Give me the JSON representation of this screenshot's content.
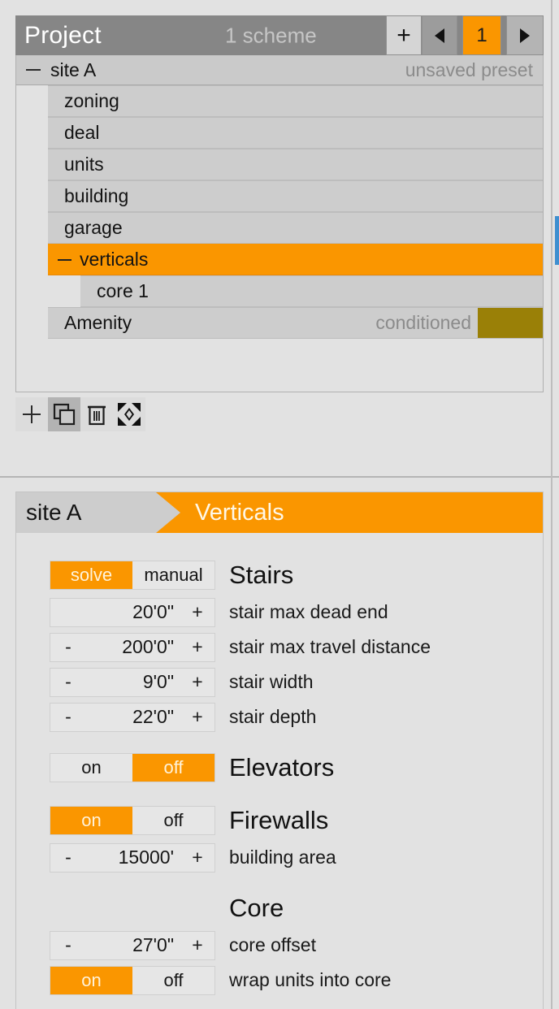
{
  "project_panel": {
    "title": "Project",
    "scheme_count": "1 scheme",
    "controls": {
      "add_label": "+",
      "prev_label": "prev-scheme",
      "current_scheme": "1",
      "next_label": "next-scheme"
    },
    "preset_row": {
      "name": "site A",
      "state": "unsaved preset"
    },
    "tree": [
      {
        "label": "zoning",
        "level": 1,
        "selected": false,
        "dash": false,
        "meta": "",
        "swatch": ""
      },
      {
        "label": "deal",
        "level": 1,
        "selected": false,
        "dash": false,
        "meta": "",
        "swatch": ""
      },
      {
        "label": "units",
        "level": 1,
        "selected": false,
        "dash": false,
        "meta": "",
        "swatch": ""
      },
      {
        "label": "building",
        "level": 1,
        "selected": false,
        "dash": false,
        "meta": "",
        "swatch": ""
      },
      {
        "label": "garage",
        "level": 1,
        "selected": false,
        "dash": false,
        "meta": "",
        "swatch": ""
      },
      {
        "label": "verticals",
        "level": 1,
        "selected": true,
        "dash": true,
        "meta": "",
        "swatch": ""
      },
      {
        "label": "core 1",
        "level": 2,
        "selected": false,
        "dash": false,
        "meta": "",
        "swatch": ""
      },
      {
        "label": "Amenity",
        "level": 1,
        "selected": false,
        "dash": false,
        "meta": "conditioned",
        "swatch": "#9a8007"
      }
    ],
    "toolbar": [
      {
        "name": "add-item-button",
        "icon": "plus-icon",
        "active": false
      },
      {
        "name": "duplicate-item-button",
        "icon": "duplicate-icon",
        "active": true
      },
      {
        "name": "delete-item-button",
        "icon": "trash-icon",
        "active": false
      },
      {
        "name": "expand-button",
        "icon": "expand-icon",
        "active": false
      }
    ]
  },
  "params_panel": {
    "breadcrumb": {
      "parent": "site A",
      "current": "Verticals"
    },
    "sections": [
      {
        "heading": "Stairs",
        "heading_control": {
          "type": "toggle",
          "options": [
            "solve",
            "manual"
          ],
          "selected": "solve"
        },
        "rows": [
          {
            "type": "stepper",
            "minus": "",
            "value": "20'0\"",
            "plus": "+",
            "label": "stair max dead end"
          },
          {
            "type": "stepper",
            "minus": "-",
            "value": "200'0\"",
            "plus": "+",
            "label": "stair max travel distance"
          },
          {
            "type": "stepper",
            "minus": "-",
            "value": "9'0\"",
            "plus": "+",
            "label": "stair width"
          },
          {
            "type": "stepper",
            "minus": "-",
            "value": "22'0\"",
            "plus": "+",
            "label": "stair depth"
          }
        ]
      },
      {
        "heading": "Elevators",
        "heading_control": {
          "type": "toggle",
          "options": [
            "on",
            "off"
          ],
          "selected": "off"
        },
        "rows": []
      },
      {
        "heading": "Firewalls",
        "heading_control": {
          "type": "toggle",
          "options": [
            "on",
            "off"
          ],
          "selected": "on"
        },
        "rows": [
          {
            "type": "stepper",
            "minus": "-",
            "value": "15000'",
            "plus": "+",
            "label": "building area"
          }
        ]
      },
      {
        "heading": "Core",
        "heading_control": null,
        "rows": [
          {
            "type": "stepper",
            "minus": "-",
            "value": "27'0\"",
            "plus": "+",
            "label": "core offset"
          },
          {
            "type": "toggle",
            "options": [
              "on",
              "off"
            ],
            "selected": "on",
            "label": "wrap units into core"
          }
        ]
      }
    ]
  },
  "colors": {
    "accent_orange": "#fa9600",
    "accent_text": "#fff3da",
    "panel_bg": "#e2e2e2",
    "row_bg": "#cdcdcd",
    "titlebar_bg": "#868686",
    "amenity_swatch": "#9a8007",
    "edge_blue": "#3f8fd0"
  }
}
